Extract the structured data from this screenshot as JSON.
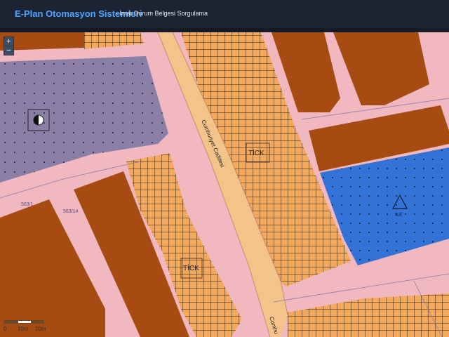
{
  "header": {
    "title": "E-Plan Otomasyon Sistemleri",
    "subtitle": "- İmar Durum Belgesi Sorgulama"
  },
  "map_controls": {
    "zoom_in": "+",
    "zoom_out": "−"
  },
  "map_labels": {
    "street_name_1": "Cumhuriyet Caddesi",
    "street_name_2": "Cumhu",
    "commercial_1": "TİCK",
    "commercial_2": "TİCK",
    "primary_school": "İLK",
    "parcel_1": "563/1",
    "parcel_2": "563/14"
  },
  "scale_bar": {
    "labels": [
      "0",
      "10m",
      "20m"
    ]
  },
  "colors": {
    "header_bg": "#1c2333",
    "title": "#4da6ff",
    "road": "#f1b8c0",
    "avenue": "#f3c38a",
    "commercial": "#f4a85c",
    "residential": "#a64b12",
    "school": "#3372d6",
    "public_area": "#8a7fa6"
  },
  "icons": {
    "mosque_symbol": "half-circle-icon",
    "school_symbol": "triangle-icon"
  }
}
